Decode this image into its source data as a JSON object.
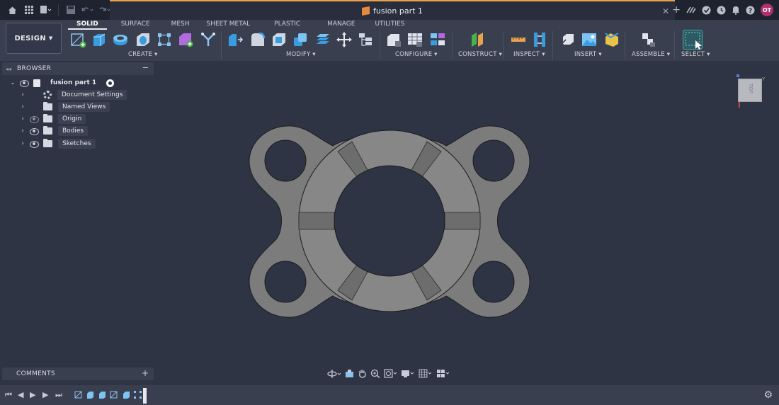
{
  "titlebar": {
    "doc_title": "fusion part 1",
    "avatar_initials": "OT",
    "icons": [
      "home-icon",
      "apps-grid-icon",
      "file-menu-icon",
      "save-icon",
      "undo-icon",
      "redo-icon",
      "new-tab-icon",
      "extensions-icon",
      "job-status-icon",
      "notifications-icon",
      "help-icon"
    ]
  },
  "toolbar": {
    "workspace_label": "DESIGN",
    "tabs": [
      "SOLID",
      "SURFACE",
      "MESH",
      "SHEET METAL",
      "PLASTIC",
      "MANAGE",
      "UTILITIES"
    ],
    "active_tab": "SOLID",
    "groups": {
      "create": "CREATE",
      "modify": "MODIFY",
      "configure": "CONFIGURE",
      "construct": "CONSTRUCT",
      "inspect": "INSPECT",
      "insert": "INSERT",
      "assemble": "ASSEMBLE",
      "select": "SELECT"
    }
  },
  "browser": {
    "title": "BROWSER",
    "root": "fusion part 1",
    "items": [
      {
        "label": "Document Settings",
        "icon": "gear-icon"
      },
      {
        "label": "Named Views",
        "icon": "folder-icon"
      },
      {
        "label": "Origin",
        "icon": "folder-icon"
      },
      {
        "label": "Bodies",
        "icon": "folder-icon"
      },
      {
        "label": "Sketches",
        "icon": "folder-icon"
      }
    ]
  },
  "viewcube": {
    "face": "TOP",
    "axis_y": "Y"
  },
  "comments": {
    "title": "COMMENTS"
  },
  "colors": {
    "background": "#2f3445",
    "part_face": "#858585",
    "part_shade": "#6e6e6e",
    "accent_orange": "#e8a24a",
    "avatar": "#b0306b"
  }
}
